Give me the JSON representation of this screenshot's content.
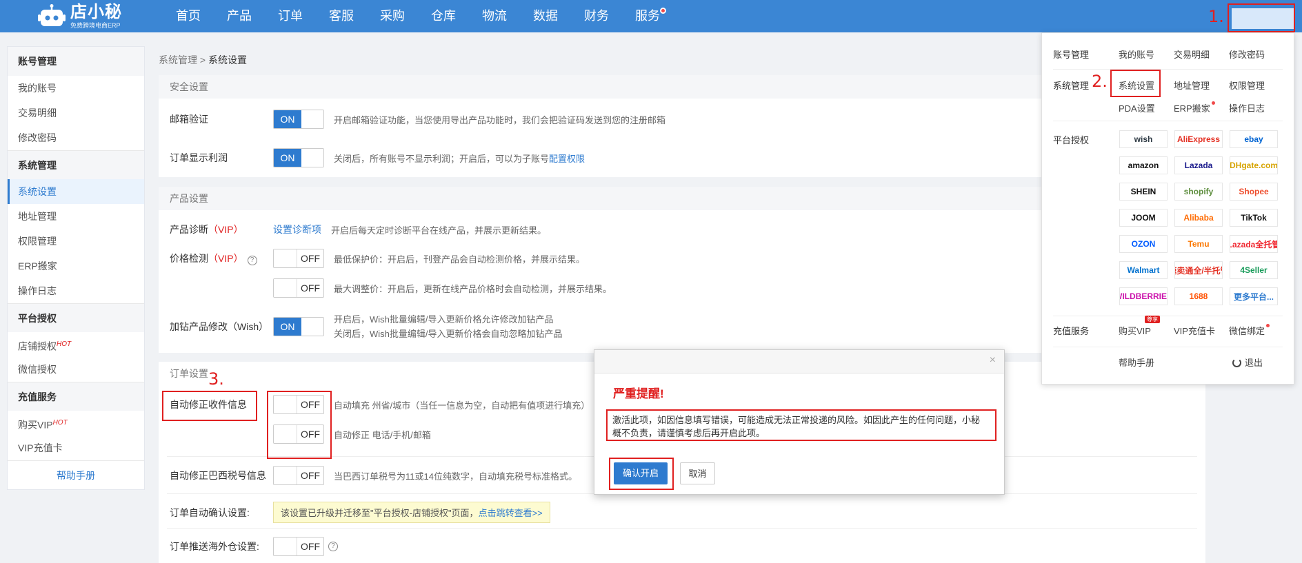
{
  "header": {
    "logo_name": "店小秘",
    "logo_sub": "免费跨境电商ERP",
    "nav": [
      "首页",
      "产品",
      "订单",
      "客服",
      "采购",
      "仓库",
      "物流",
      "数据",
      "财务",
      "服务"
    ]
  },
  "markers": {
    "m1": "1.",
    "m2": "2.",
    "m3": "3."
  },
  "sidebar": {
    "sections": [
      {
        "title": "账号管理",
        "items": [
          "我的账号",
          "交易明细",
          "修改密码"
        ]
      },
      {
        "title": "系统管理",
        "items": [
          "系统设置",
          "地址管理",
          "权限管理",
          "ERP搬家",
          "操作日志"
        ]
      },
      {
        "title": "平台授权",
        "items": [
          "店铺授权",
          "微信授权"
        ]
      },
      {
        "title": "充值服务",
        "items": [
          "购买VIP",
          "VIP充值卡"
        ]
      }
    ],
    "hot": "HOT",
    "help": "帮助手册"
  },
  "breadcrumb": {
    "parent": "系统管理",
    "sep": " > ",
    "current": "系统设置"
  },
  "security": {
    "title": "安全设置",
    "email_label": "邮箱验证",
    "email_toggle": "ON",
    "email_desc": "开启邮箱验证功能，当您使用导出产品功能时，我们会把验证码发送到您的注册邮箱",
    "profit_label": "订单显示利润",
    "profit_toggle": "ON",
    "profit_desc": "关闭后，所有账号不显示利润；开启后，可以为子账号",
    "profit_link": "配置权限"
  },
  "product": {
    "title": "产品设置",
    "diag_label": "产品诊断",
    "vip": "（VIP）",
    "diag_link": "设置诊断项",
    "diag_desc": "开启后每天定时诊断平台在线产品，并展示更新结果。",
    "price_label": "价格检测",
    "price_toggle1": "OFF",
    "price_desc1": "最低保护价：开启后，刊登产品会自动检测价格，并展示结果。",
    "price_toggle2": "OFF",
    "price_desc2": "最大调整价：开启后，更新在线产品价格时会自动检测，并展示结果。",
    "wish_label": "加钻产品修改（Wish）",
    "wish_toggle": "ON",
    "wish_desc1": "开启后，Wish批量编辑/导入更新价格允许修改加钻产品",
    "wish_desc2": "关闭后，Wish批量编辑/导入更新价格会自动忽略加钻产品"
  },
  "order": {
    "title": "订单设置",
    "fix_label": "自动修正收件信息",
    "fix_toggle1": "OFF",
    "fix_desc1": "自动填充 州省/城市（当任一信息为空，自动把有值项进行填充）",
    "fix_toggle2": "OFF",
    "fix_desc2": "自动修正 电话/手机/邮箱",
    "br_label": "自动修正巴西税号信息",
    "br_toggle": "OFF",
    "br_desc": "当巴西订单税号为11或14位纯数字，自动填充税号标准格式。",
    "confirm_label": "订单自动确认设置:",
    "confirm_notice": "该设置已升级并迁移至\"平台授权-店铺授权\"页面，",
    "confirm_link": "点击跳转查看>>",
    "push_label": "订单推送海外仓设置:",
    "push_toggle": "OFF"
  },
  "dropdown": {
    "account": {
      "title": "账号管理",
      "links": [
        "我的账号",
        "交易明细",
        "修改密码"
      ]
    },
    "system": {
      "title": "系统管理",
      "links": [
        "系统设置",
        "地址管理",
        "权限管理",
        "PDA设置",
        "ERP搬家",
        "操作日志"
      ]
    },
    "platforms": {
      "title": "平台授权",
      "items": [
        {
          "name": "wish",
          "color": "#2f3b45"
        },
        {
          "name": "AliExpress",
          "color": "#e43225"
        },
        {
          "name": "ebay",
          "color": "#0064d2"
        },
        {
          "name": "amazon",
          "color": "#111111"
        },
        {
          "name": "Lazada",
          "color": "#1a1a8c"
        },
        {
          "name": "DHgate.com",
          "color": "#d6a300"
        },
        {
          "name": "SHEIN",
          "color": "#111111"
        },
        {
          "name": "shopify",
          "color": "#5e8e3e"
        },
        {
          "name": "Shopee",
          "color": "#ee4d2d"
        },
        {
          "name": "JOOM",
          "color": "#111111"
        },
        {
          "name": "Alibaba",
          "color": "#ff6a00"
        },
        {
          "name": "TikTok",
          "color": "#111111"
        },
        {
          "name": "OZON",
          "color": "#005bff"
        },
        {
          "name": "Temu",
          "color": "#fb7701"
        },
        {
          "name": "Lazada全托管",
          "color": "#f0262f"
        },
        {
          "name": "Walmart",
          "color": "#0071ce"
        },
        {
          "name": "速卖通全/半托管",
          "color": "#e43225"
        },
        {
          "name": "4Seller",
          "color": "#1a9c5b"
        },
        {
          "name": "WILDBERRIES",
          "color": "#cb11ab"
        },
        {
          "name": "1688",
          "color": "#ff5000"
        },
        {
          "name": "更多平台...",
          "color": "#2e7bcf"
        }
      ]
    },
    "recharge": {
      "title": "充值服务",
      "links": [
        "购买VIP",
        "VIP充值卡",
        "微信绑定"
      ],
      "badge": "尊享"
    },
    "help": "帮助手册",
    "logout": "退出"
  },
  "modal": {
    "close": "×",
    "title": "严重提醒!",
    "message": "激活此项，如因信息填写错误，可能造成无法正常投递的风险。如因此产生的任何问题，小秘概不负责，请谨慎考虑后再开启此项。",
    "ok": "确认开启",
    "cancel": "取消"
  }
}
